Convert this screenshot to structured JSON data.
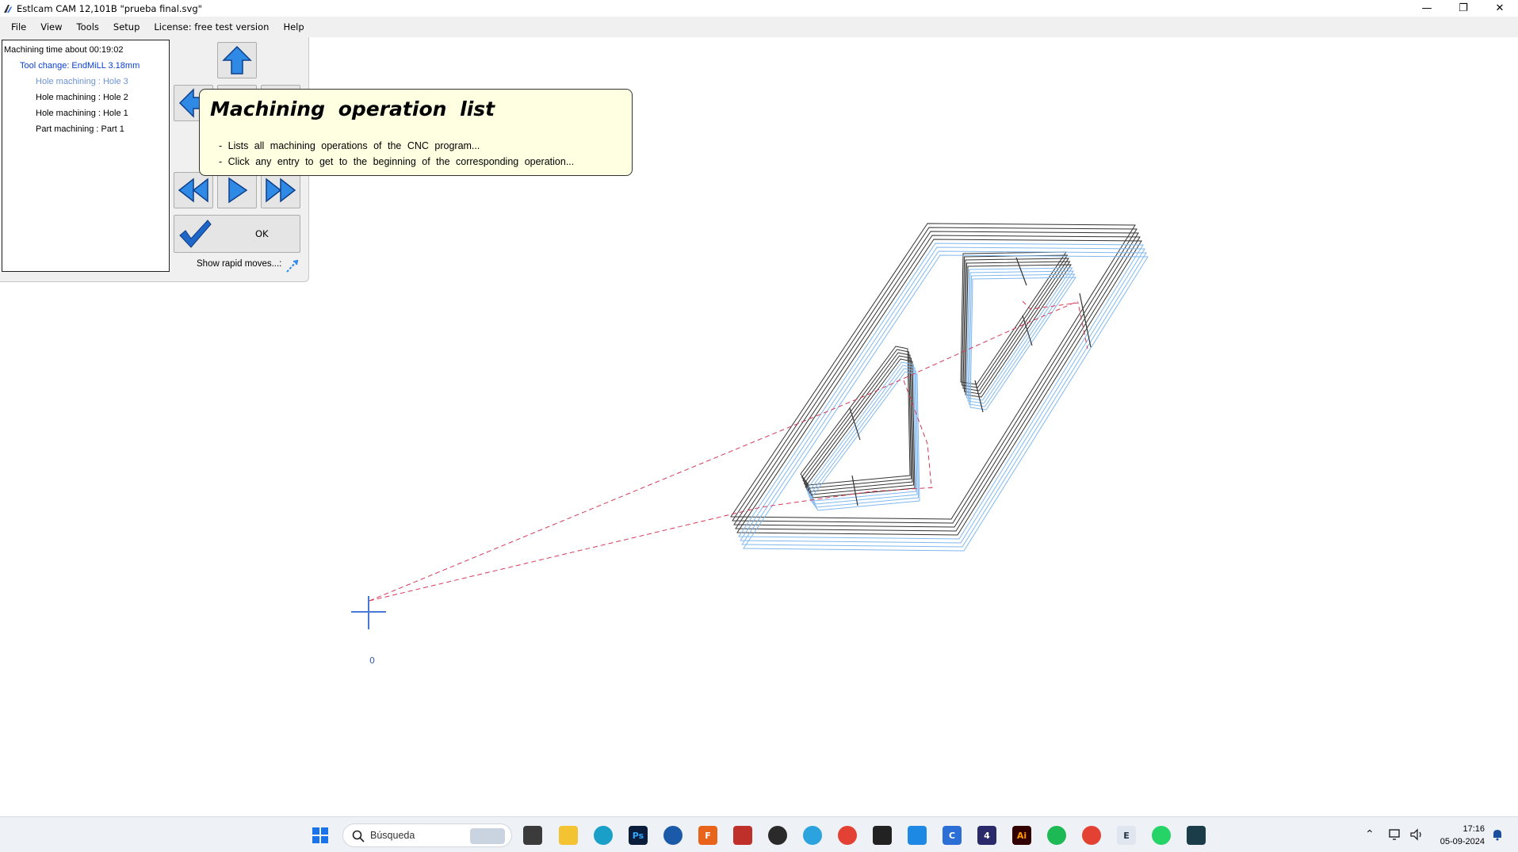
{
  "window": {
    "title": "Estlcam CAM 12,101B \"prueba final.svg\"",
    "minimize": "—",
    "restore": "❐",
    "close": "✕"
  },
  "menu": [
    "File",
    "View",
    "Tools",
    "Setup",
    "License: free test version",
    "Help"
  ],
  "operations": {
    "time": "Machining time about 00:19:02",
    "tool_change": "Tool change: EndMiLL 3.18mm",
    "items": [
      "Hole machining : Hole 3",
      "Hole machining : Hole 2",
      "Hole machining : Hole 1",
      "Part machining : Part 1"
    ]
  },
  "controls": {
    "ok_label": "OK",
    "rapid_label": "Show rapid moves...:"
  },
  "tooltip": {
    "title": "Machining operation list",
    "line1": "- Lists all machining operations of the CNC program...",
    "line2": "- Click any entry to get to the beginning of the corresponding operation..."
  },
  "canvas": {
    "origin_label": "0",
    "toolpath_color": "#333333",
    "offset_color": "#7fb8ef",
    "rapid_color": "#d63a5a"
  },
  "taskbar": {
    "search_placeholder": "Búsqueda",
    "time": "17:16",
    "date": "05-09-2024"
  }
}
